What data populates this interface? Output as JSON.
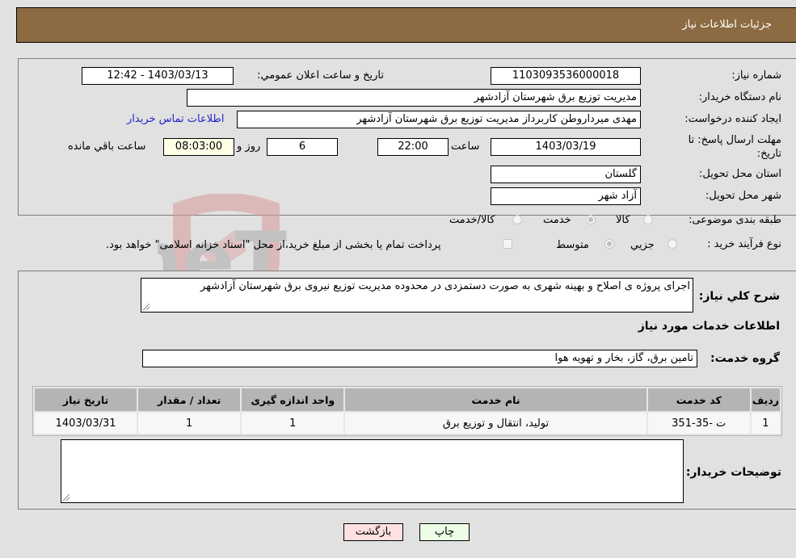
{
  "header": {
    "title": "جزئیات اطلاعات نیاز"
  },
  "fields": {
    "need_number": {
      "label": "شماره نیاز:",
      "value": "1103093536000018"
    },
    "announce_datetime": {
      "label": "تاریخ و ساعت اعلان عمومي:",
      "value": "1403/03/13 - 12:42"
    },
    "buyer_org": {
      "label": "نام دستگاه خريدار:",
      "value": "مدیریت توزیع برق شهرستان آزادشهر"
    },
    "requester": {
      "label": "ايجاد کننده درخواست:",
      "value": "مهدی میرداروطن کاربرداز مدیریت توزیع برق شهرستان آزادشهر"
    },
    "buyer_contact_link": "اطلاعات تماس خريدار",
    "deadline": {
      "label_line1": "مهلت ارسال پاسخ: تا",
      "label_line2": "تاريخ:",
      "date": "1403/03/19",
      "time_label": "ساعت",
      "time": "22:00",
      "days": "6",
      "days_label": "روز و",
      "remaining": "08:03:00",
      "remaining_label": "ساعت باقي مانده"
    },
    "province": {
      "label": "استان محل تحويل:",
      "value": "گلستان"
    },
    "city": {
      "label": "شهر محل تحويل:",
      "value": "آزاد شهر"
    },
    "category": {
      "label": "طبقه بندی موضوعی:",
      "options": [
        "کالا",
        "خدمت",
        "کالا/خدمت"
      ],
      "selected": "خدمت"
    },
    "purchase_type": {
      "label": "نوع فرآيند خريد :",
      "options": [
        "جزيي",
        "متوسط"
      ],
      "selected": "متوسط",
      "treasury_note": "پرداخت تمام یا بخشی از مبلغ خرید،از محل \"اسناد خزانه اسلامی\" خواهد بود."
    }
  },
  "description": {
    "label": "شرح کلي نياز:",
    "value": "اجرای پروژه ی اصلاح و بهینه شهری به صورت دستمزدی در محدوده مدیریت توزیع نیروی برق شهرستان آزادشهر"
  },
  "services_section": {
    "title": "اطلاعات خدمات مورد نياز",
    "group_label": "گروه خدمت:",
    "group_value": "تامين برق، گاز، بخار و تهويه هوا",
    "table": {
      "headers": [
        "رديف",
        "کد خدمت",
        "نام خدمت",
        "واحد اندازه گيری",
        "تعداد / مقدار",
        "تاريخ نياز"
      ],
      "rows": [
        [
          "1",
          "ت -35-351",
          "توليد، انتقال و توزيع برق",
          "1",
          "1",
          "1403/03/31"
        ]
      ]
    }
  },
  "buyer_notes": {
    "label": "توضيحات خريدار:",
    "value": ""
  },
  "buttons": {
    "print": "چاپ",
    "back": "بازگشت"
  },
  "watermark": {
    "text": "AriaTender.neT"
  }
}
